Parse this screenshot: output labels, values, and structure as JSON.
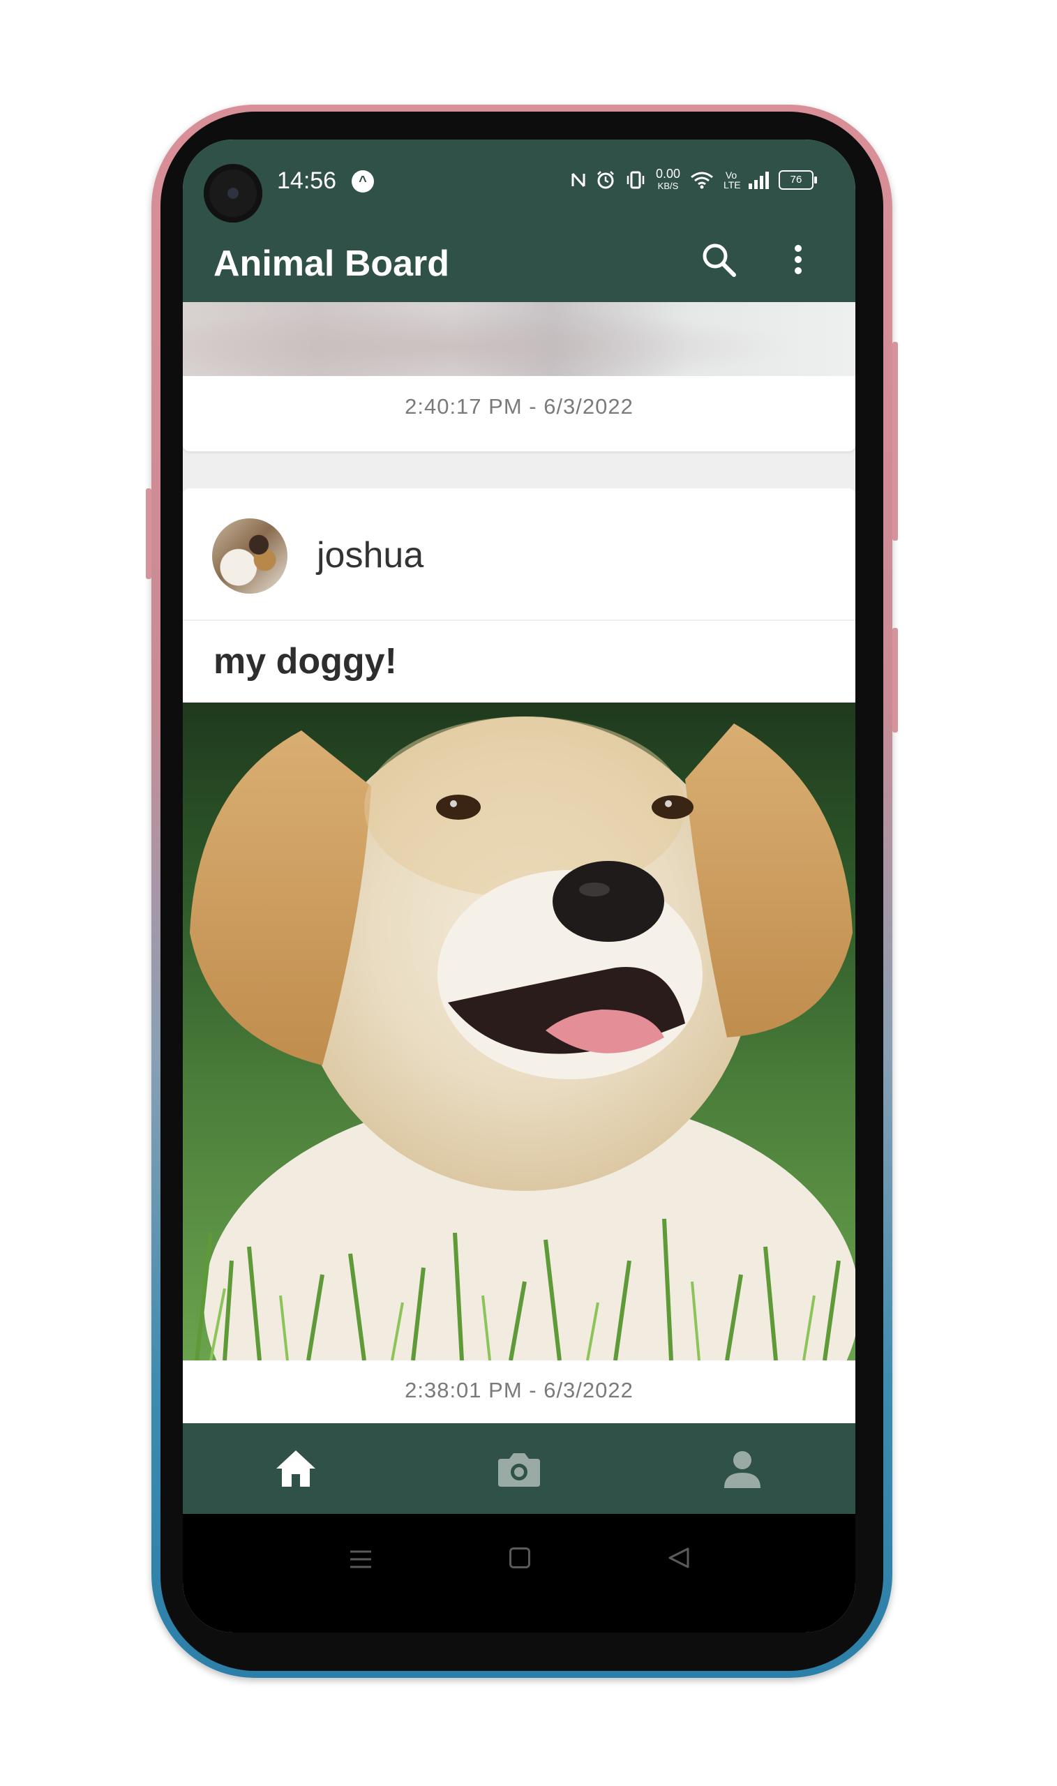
{
  "status_bar": {
    "time": "14:56",
    "net_speed_value": "0.00",
    "net_speed_unit": "KB/S",
    "volte": "Vo LTE",
    "battery": "76",
    "icons": [
      "nav-arrow-icon",
      "nfc-icon",
      "alarm-icon",
      "vibrate-icon",
      "wifi-icon",
      "signal-icon",
      "battery-icon"
    ]
  },
  "app_bar": {
    "title": "Animal Board",
    "icons": [
      "search-icon",
      "more-vert-icon"
    ]
  },
  "feed": {
    "posts": [
      {
        "timestamp": "2:40:17 PM - 6/3/2022"
      },
      {
        "username": "joshua",
        "caption": "my doggy!",
        "timestamp": "2:38:01 PM - 6/3/2022"
      }
    ]
  },
  "bottom_nav": {
    "items": [
      "home-icon",
      "camera-icon",
      "profile-icon"
    ],
    "active": "home-icon"
  },
  "system_nav": {
    "items": [
      "recents-icon",
      "home-square-icon",
      "back-triangle-icon"
    ]
  },
  "colors": {
    "primary": "#305148",
    "nav_active": "#ffffff",
    "nav_inactive": "#9aaba5"
  }
}
